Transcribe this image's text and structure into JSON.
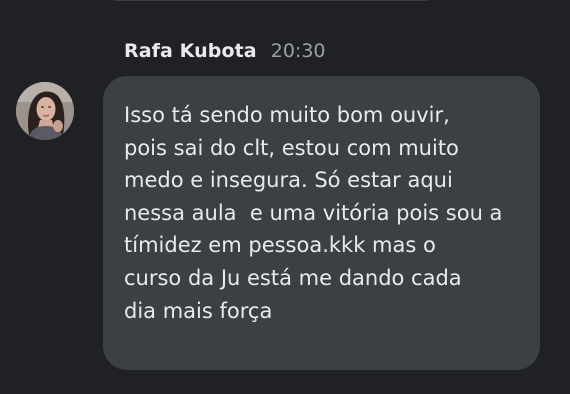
{
  "message": {
    "sender": "Rafa Kubota",
    "time": "20:30",
    "text": "Isso tá sendo muito bom ouvir,\npois sai do clt, estou com muito\nmedo e insegura. Só estar aqui\nnessa aula  e uma vitória pois sou a\ntímidez em pessoa.kkk mas o\ncurso da Ju está me dando cada\ndia mais força"
  },
  "colors": {
    "background": "#202124",
    "bubble": "#3c4043",
    "text": "#e8eaed",
    "timestamp": "#9aa0a6"
  },
  "icons": {
    "avatar": "user-photo-avatar"
  }
}
